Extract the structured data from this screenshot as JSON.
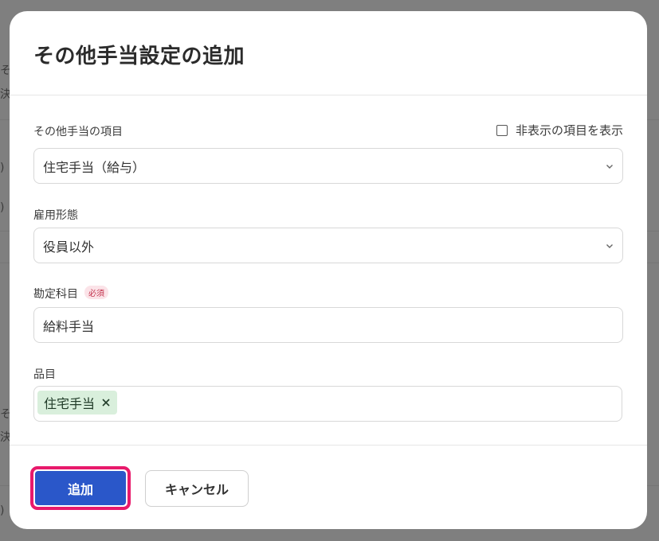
{
  "background": {
    "fragments": [
      "そ",
      "決さ",
      ")",
      ")",
      "そ",
      "決さ",
      ")"
    ]
  },
  "dialog": {
    "title": "その他手当設定の追加",
    "show_hidden_label": "非表示の項目を表示",
    "show_hidden_checked": false,
    "allowance_item": {
      "label": "その他手当の項目",
      "value": "住宅手当（給与）"
    },
    "employment_type": {
      "label": "雇用形態",
      "value": "役員以外"
    },
    "account": {
      "label": "勘定科目",
      "required_badge": "必須",
      "value": "給料手当"
    },
    "item": {
      "label": "品目",
      "tag": "住宅手当"
    },
    "buttons": {
      "add": "追加",
      "cancel": "キャンセル"
    },
    "colors": {
      "primary": "#2a57c9",
      "focus": "#e8196b",
      "tag_bg": "#d9efdc"
    }
  }
}
